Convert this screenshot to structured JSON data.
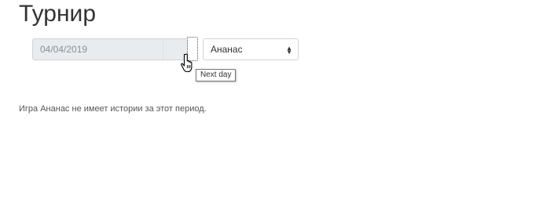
{
  "page": {
    "title": "Турнир"
  },
  "filters": {
    "date_value": "04/04/2019",
    "game_selected": "Ананас",
    "select_arrow_icon": "updown-caret-icon"
  },
  "next_day": {
    "tooltip": "Next day",
    "cursor_icon": "hand-pointer-icon"
  },
  "message": {
    "text": "Игра Ананас не имеет истории за этот период."
  }
}
